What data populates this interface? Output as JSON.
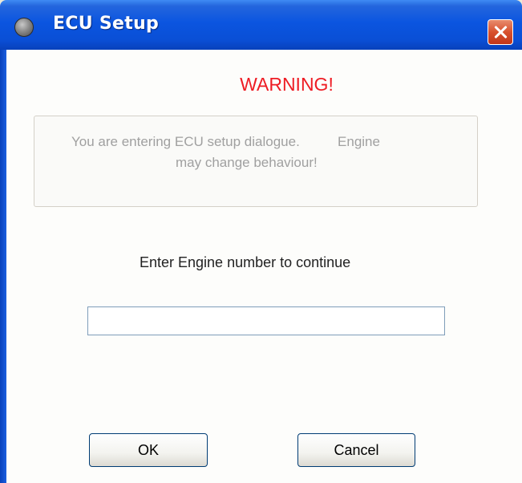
{
  "window": {
    "title": "ECU Setup",
    "icon": "app-icon",
    "close_icon": "close-icon"
  },
  "dialog": {
    "warning_title": "WARNING!",
    "message_line1": "You are entering ECU setup dialogue.          Engine",
    "message_line2": "may change behaviour!",
    "prompt_label": "Enter Engine number to continue",
    "engine_number_value": "",
    "engine_number_placeholder": ""
  },
  "buttons": {
    "ok_label": "OK",
    "cancel_label": "Cancel"
  },
  "colors": {
    "titlebar": "#0a4fd6",
    "warning": "#ee1c24",
    "close_button": "#d8512e",
    "message_text": "#a0a0a0"
  }
}
